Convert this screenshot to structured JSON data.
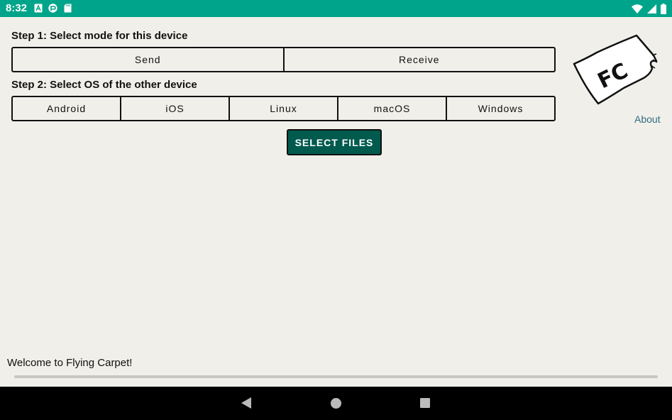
{
  "status_bar": {
    "time": "8:32",
    "left_icons": [
      "a-icon",
      "vpn-icon",
      "sd-card-icon"
    ],
    "right_icons": [
      "wifi-icon",
      "signal-icon",
      "battery-icon"
    ]
  },
  "step1": {
    "label": "Step 1: Select mode for this device",
    "options": [
      "Send",
      "Receive"
    ]
  },
  "step2": {
    "label": "Step 2: Select OS of the other device",
    "options": [
      "Android",
      "iOS",
      "Linux",
      "macOS",
      "Windows"
    ]
  },
  "select_files_label": "SELECT FILES",
  "logo": {
    "text": "FC"
  },
  "about_label": "About",
  "welcome_text": "Welcome to Flying Carpet!",
  "progress": {
    "value": 0
  },
  "colors": {
    "status_bar": "#00a48a",
    "primary_button": "#005a4e",
    "background": "#f1efea",
    "link": "#2f6b80"
  },
  "nav": [
    "back-icon",
    "home-icon",
    "recents-icon"
  ]
}
